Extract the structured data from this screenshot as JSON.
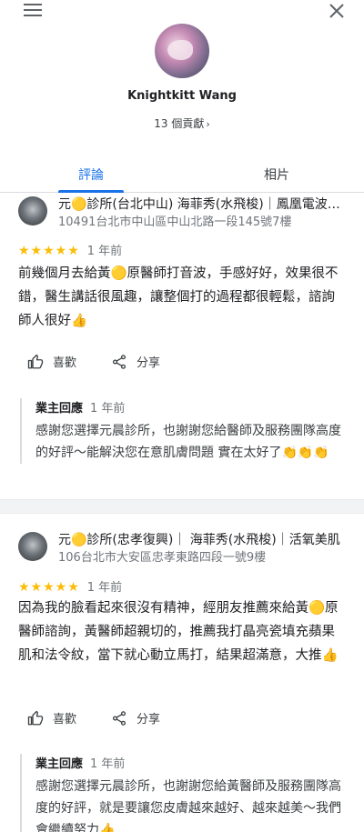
{
  "header": {
    "menu_icon": "hamburger-menu-icon",
    "close_icon": "close-icon"
  },
  "profile": {
    "name": "Knightkitt Wang",
    "contributions": "13 個貢獻"
  },
  "tabs": [
    {
      "label": "評論",
      "active": true
    },
    {
      "label": "相片",
      "active": false
    }
  ],
  "colors": {
    "accent": "#1a73e8",
    "star": "#fbbc04"
  },
  "reviews": [
    {
      "place_name": "元🟡診所(台北中山) 海菲秀(水飛梭)｜鳳凰電波｜音波拉皮",
      "place_address": "10491台北市中山區中山北路一段145號7樓",
      "stars": "★★★★★",
      "time": "1 年前",
      "text": "前幾個月去給黃🟡原醫師打音波，手感好好，效果很不錯，醫生講話很風趣，讓整個打的過程都很輕鬆，諮詢師人很好👍",
      "like_label": "喜歡",
      "share_label": "分享",
      "owner_label": "業主回應",
      "owner_time": "1 年前",
      "owner_text": "感謝您選擇元晨診所，也謝謝您給醫師及服務團隊高度的好評～能解決您在意肌膚問題 實在太好了👏👏👏"
    },
    {
      "place_name": "元🟡診所(忠孝復興)｜ 海菲秀(水飛梭)｜活氧美肌",
      "place_address": "106台北市大安區忠孝東路四段一號9樓",
      "stars": "★★★★★",
      "time": "1 年前",
      "text": "因為我的臉看起來很沒有精神，經朋友推薦來給黃🟡原醫師諮詢，黃醫師超親切的，推薦我打晶亮瓷填充蘋果肌和法令紋，當下就心動立馬打，結果超滿意，大推👍",
      "like_label": "喜歡",
      "share_label": "分享",
      "owner_label": "業主回應",
      "owner_time": "1 年前",
      "owner_text": "感謝您選擇元晨診所，也謝謝您給黃醫師及服務團隊高度的好評，就是要讓您皮膚越來越好、越來越美～我們會繼續努力👍"
    }
  ]
}
